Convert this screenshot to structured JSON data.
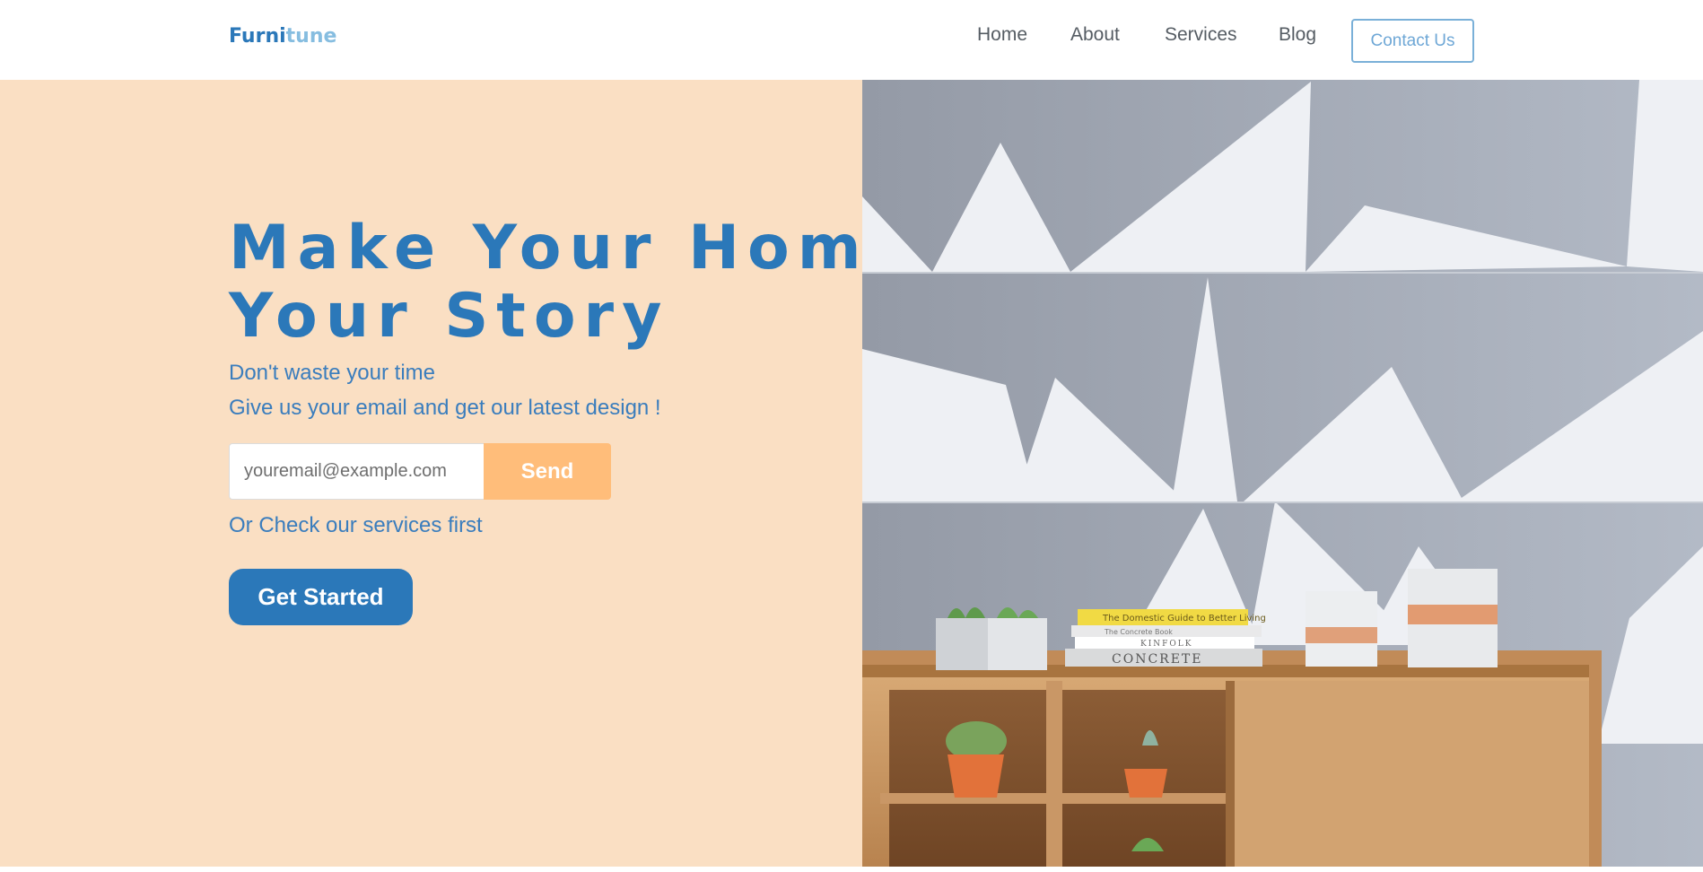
{
  "header": {
    "brand_part1": "Furni",
    "brand_part2": "tune",
    "nav": [
      "Home",
      "About",
      "Services",
      "Blog"
    ],
    "contact_label": "Contact Us"
  },
  "hero": {
    "headline_line1": "Make Your Home",
    "headline_line2": "Your Story",
    "subtitle_line1": "Don't waste your time",
    "subtitle_line2": "Give us your email and get our latest design !",
    "email_placeholder": "youremail@example.com",
    "send_label": "Send",
    "services_text": "Or Check our services first",
    "cta_label": "Get Started"
  },
  "image": {
    "book_titles": [
      "The Domestic Guide to Better Living",
      "The Concrete Book",
      "KINFOLK",
      "CONCRETE"
    ]
  },
  "colors": {
    "primary": "#2b78b9",
    "light_blue": "#86bde0",
    "peach_background": "#fadfc3",
    "send_button": "#ffbd7a",
    "wall_gray": "#9aa0ad"
  }
}
